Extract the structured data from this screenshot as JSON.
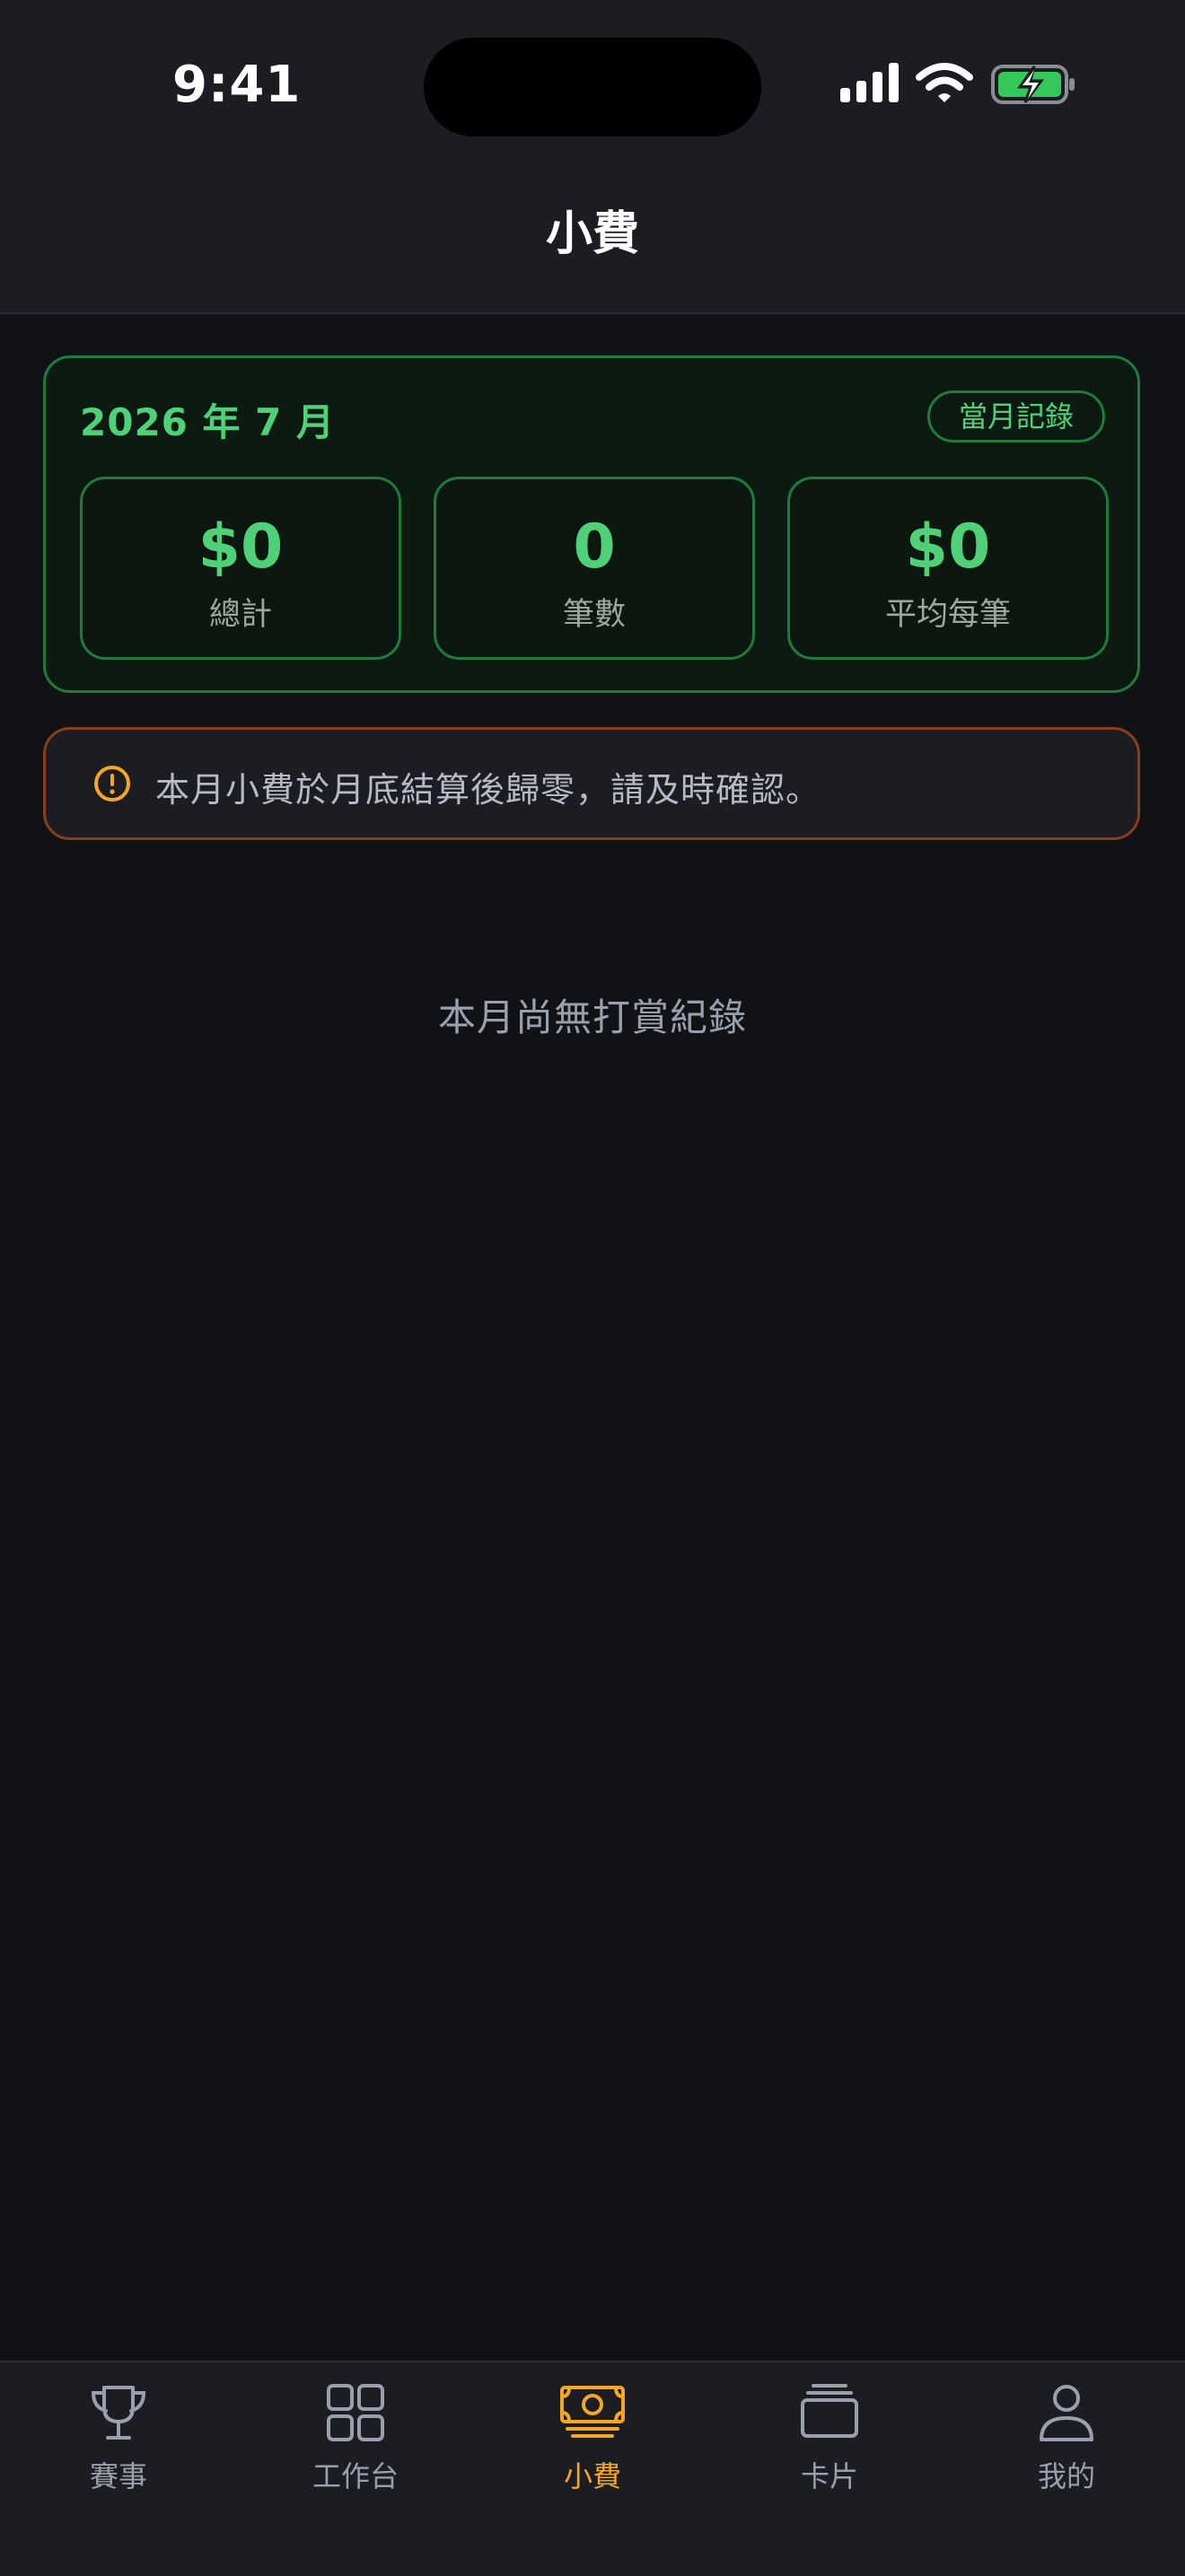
{
  "status_bar": {
    "time": "9:41"
  },
  "header": {
    "title": "小費"
  },
  "summary": {
    "month": "2026 年 7 月",
    "badge": "當月記錄",
    "stats": [
      {
        "value": "$0",
        "label": "總計"
      },
      {
        "value": "0",
        "label": "筆數"
      },
      {
        "value": "$0",
        "label": "平均每筆"
      }
    ]
  },
  "notice": {
    "text": "本月小費於月底結算後歸零，請及時確認。",
    "icon": "alert-circle-icon"
  },
  "empty_state": {
    "text": "本月尚無打賞紀錄"
  },
  "tabs": [
    {
      "label": "賽事",
      "icon": "trophy-icon",
      "active": false
    },
    {
      "label": "工作台",
      "icon": "grid-icon",
      "active": false
    },
    {
      "label": "小費",
      "icon": "money-icon",
      "active": true
    },
    {
      "label": "卡片",
      "icon": "cards-icon",
      "active": false
    },
    {
      "label": "我的",
      "icon": "person-icon",
      "active": false
    }
  ],
  "colors": {
    "accent_green": "#4fd17a",
    "accent_orange": "#f5a623",
    "background": "#111216"
  }
}
